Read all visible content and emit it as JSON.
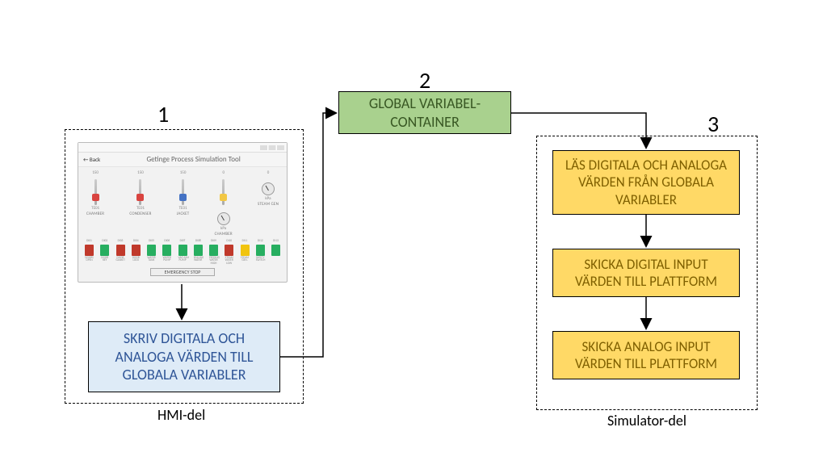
{
  "numbers": {
    "one": "1",
    "two": "2",
    "three": "3"
  },
  "labels": {
    "hmi_part": "HMI-del",
    "sim_part": "Simulator-del"
  },
  "boxes": {
    "blue": "SKRIV DIGITALA OCH ANALOGA VÄRDEN TILL GLOBALA VARIABLER",
    "green_l1": "GLOBAL VARIABEL-",
    "green_l2": "CONTAINER",
    "y1": "LÄS DIGITALA OCH ANALOGA VÄRDEN FRÅN GLOBALA VARIABLER",
    "y2": "SKICKA DIGITAL INPUT VÄRDEN TILL PLATTFORM",
    "y3": "SKICKA ANALOG INPUT VÄRDEN TILL PLATTFORM"
  },
  "hmi": {
    "back": "←  Back",
    "title": "Getinge Process Simulation Tool",
    "gauge_tops": [
      "150",
      "150",
      "150",
      "0",
      "0"
    ],
    "gauge_units": [
      "TE01",
      "TE01",
      "TE01",
      "kPa",
      "kPa"
    ],
    "gauges": [
      "CHAMBER",
      "CONDENSER",
      "JACKET",
      "CHAMBER",
      "STEAM GEN"
    ],
    "led_top": [
      "DI01",
      "DI02",
      "DI03",
      "DI04",
      "DI05",
      "DI06",
      "DI07",
      "DI08",
      "DI09",
      "DI10",
      "DI11",
      "DI12",
      "DI13"
    ],
    "leds": [
      "DOORS OPEN",
      "DOOR KEY",
      "DOOR GASKET",
      "DOOR LOCK",
      "WATER TANK",
      "WATER PUMP",
      "VACUUM PUMP",
      "SEALING WATER",
      "FEEDING WATER HIGH",
      "STEAM WATER LOW",
      "STEAM GEN.",
      "SAFETY SWITCH",
      ""
    ],
    "stop": "EMERGENCY STOP"
  }
}
